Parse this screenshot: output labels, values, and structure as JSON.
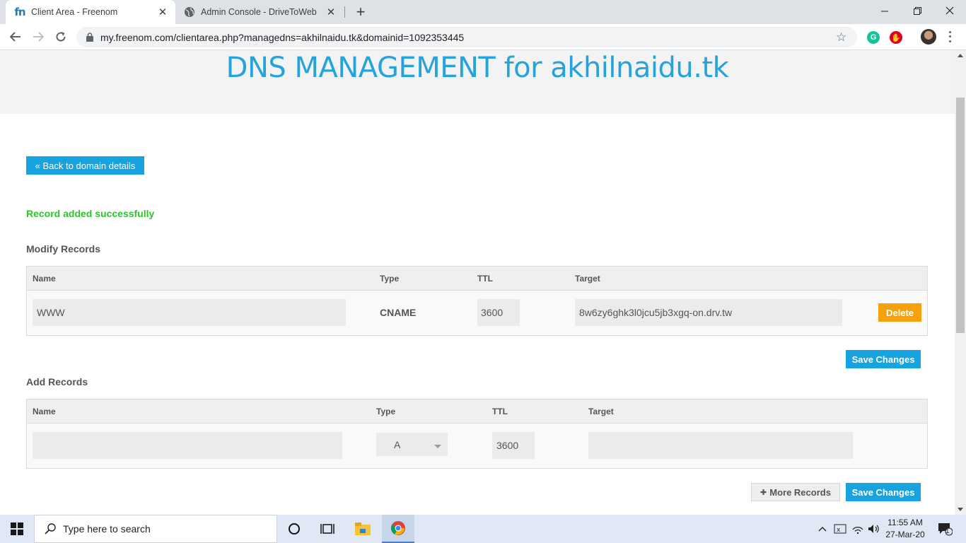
{
  "browser": {
    "tabs": [
      {
        "title": "Client Area - Freenom",
        "favicon": "fn",
        "active": true
      },
      {
        "title": "Admin Console - DriveToWeb",
        "favicon": "globe-icon",
        "active": false
      }
    ],
    "url": "my.freenom.com/clientarea.php?managedns=akhilnaidu.tk&domainid=1092353445",
    "window_controls": [
      "minimize-icon",
      "restore-icon",
      "close-icon"
    ],
    "extensions": [
      {
        "name": "grammarly-icon",
        "color": "#15c39a",
        "glyph": "G"
      },
      {
        "name": "adblock-icon",
        "color": "#e3001b",
        "glyph": "✋"
      }
    ]
  },
  "page": {
    "heading": "DNS MANAGEMENT for akhilnaidu.tk",
    "back_button": "« Back to domain details",
    "success_message": "Record added successfully",
    "modify_section": {
      "title": "Modify Records",
      "columns": [
        "Name",
        "Type",
        "TTL",
        "Target"
      ],
      "rows": [
        {
          "name": "WWW",
          "type": "CNAME",
          "ttl": "3600",
          "target": "8w6zy6ghk3l0jcu5jb3xgq-on.drv.tw",
          "delete_label": "Delete"
        }
      ],
      "save_label": "Save Changes"
    },
    "add_section": {
      "title": "Add Records",
      "columns": [
        "Name",
        "Type",
        "TTL",
        "Target"
      ],
      "row": {
        "name": "",
        "type": "A",
        "ttl": "3600",
        "target": ""
      },
      "more_label": "More Records",
      "more_glyph": "✚",
      "save_label": "Save Changes"
    }
  },
  "taskbar": {
    "search_placeholder": "Type here to search",
    "time": "11:55 AM",
    "date": "27-Mar-20",
    "notification_count": "1"
  },
  "colors": {
    "accent_blue": "#16a3df",
    "heading_blue": "#24a3dc",
    "success_green": "#2dc42d",
    "delete_orange": "#f7a10a"
  }
}
